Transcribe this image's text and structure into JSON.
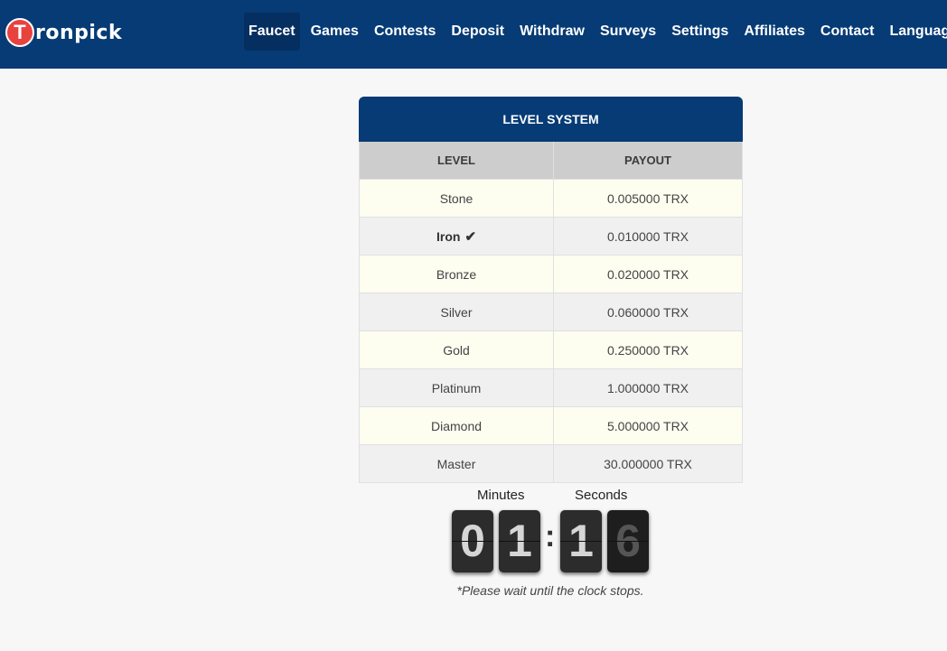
{
  "brand": {
    "logo_letter": "T",
    "logo_text": "ronpick"
  },
  "nav": {
    "items": [
      {
        "label": "Faucet",
        "active": true
      },
      {
        "label": "Games"
      },
      {
        "label": "Contests"
      },
      {
        "label": "Deposit"
      },
      {
        "label": "Withdraw"
      },
      {
        "label": "Surveys"
      },
      {
        "label": "Settings"
      },
      {
        "label": "Affiliates"
      },
      {
        "label": "Contact"
      },
      {
        "label": "Language"
      }
    ]
  },
  "level_table": {
    "title": "LEVEL SYSTEM",
    "headers": {
      "level": "LEVEL",
      "payout": "PAYOUT"
    },
    "rows": [
      {
        "level": "Stone",
        "payout": "0.005000 TRX"
      },
      {
        "level": "Iron",
        "payout": "0.010000 TRX",
        "current": true,
        "icon": "check-icon"
      },
      {
        "level": "Bronze",
        "payout": "0.020000 TRX"
      },
      {
        "level": "Silver",
        "payout": "0.060000 TRX"
      },
      {
        "level": "Gold",
        "payout": "0.250000 TRX"
      },
      {
        "level": "Platinum",
        "payout": "1.000000 TRX"
      },
      {
        "level": "Diamond",
        "payout": "5.000000 TRX"
      },
      {
        "level": "Master",
        "payout": "30.000000 TRX"
      }
    ]
  },
  "clock": {
    "minutes_label": "Minutes",
    "seconds_label": "Seconds",
    "digits": [
      "0",
      "1",
      "1",
      "6"
    ],
    "separator": ":"
  },
  "notice": "*Please wait until the clock stops.",
  "colors": {
    "navbar_bg": "#063b75",
    "active_nav_bg": "#042f60",
    "logo_red": "#e8423f",
    "row_odd": "#fdfdf0",
    "row_even": "#f0f0f0"
  }
}
